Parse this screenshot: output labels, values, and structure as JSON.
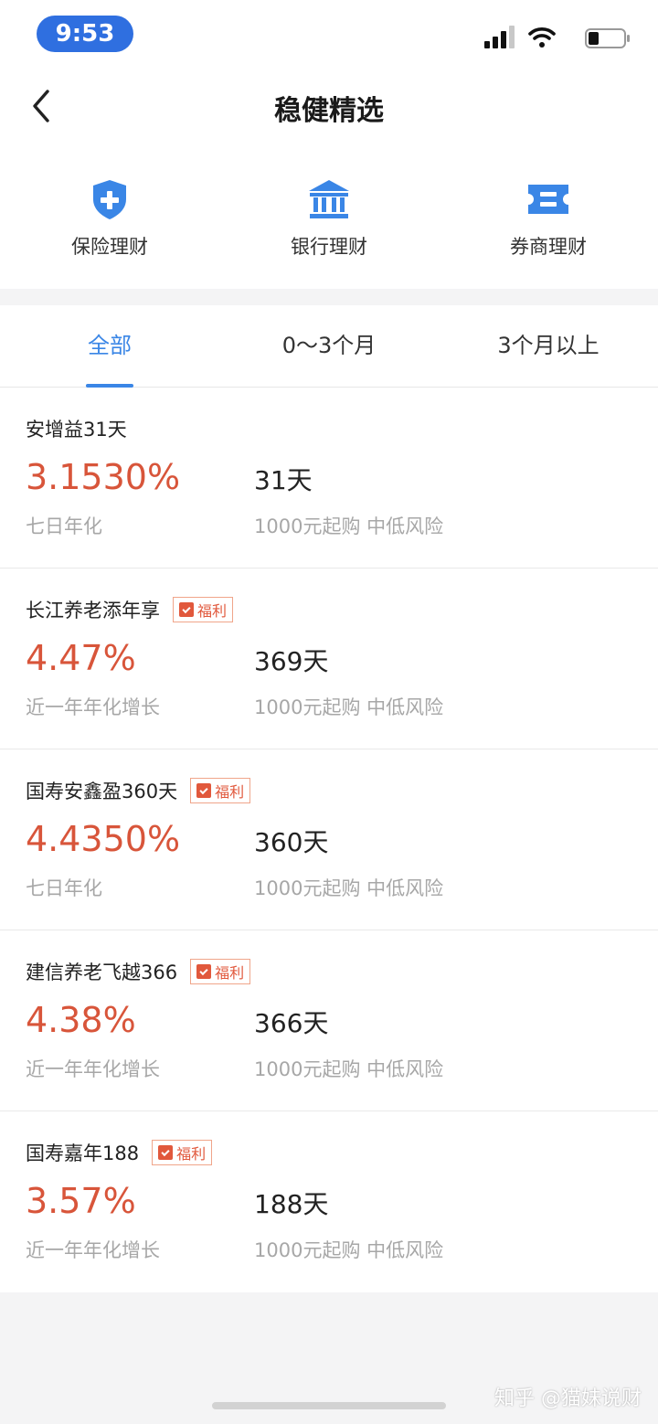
{
  "status_bar": {
    "time": "9:53"
  },
  "header": {
    "title": "稳健精选",
    "back_icon": "chevron-left-icon"
  },
  "categories": [
    {
      "label": "保险理财",
      "icon": "shield-plus-icon"
    },
    {
      "label": "银行理财",
      "icon": "bank-icon"
    },
    {
      "label": "券商理财",
      "icon": "ticket-icon"
    }
  ],
  "tabs": [
    {
      "label": "全部",
      "active": true
    },
    {
      "label": "0～3个月",
      "active": false
    },
    {
      "label": "3个月以上",
      "active": false
    }
  ],
  "products": [
    {
      "name": "安增益31天",
      "badge": "",
      "rate": "3.1530%",
      "rate_label": "七日年化",
      "term": "31天",
      "info": "1000元起购  中低风险"
    },
    {
      "name": "长江养老添年享",
      "badge": "福利",
      "rate": "4.47%",
      "rate_label": "近一年年化增长",
      "term": "369天",
      "info": "1000元起购  中低风险"
    },
    {
      "name": "国寿安鑫盈360天",
      "badge": "福利",
      "rate": "4.4350%",
      "rate_label": "七日年化",
      "term": "360天",
      "info": "1000元起购  中低风险"
    },
    {
      "name": "建信养老飞越366",
      "badge": "福利",
      "rate": "4.38%",
      "rate_label": "近一年年化增长",
      "term": "366天",
      "info": "1000元起购  中低风险"
    },
    {
      "name": "国寿嘉年188",
      "badge": "福利",
      "rate": "3.57%",
      "rate_label": "近一年年化增长",
      "term": "188天",
      "info": "1000元起购  中低风险"
    }
  ],
  "watermark": "知乎 @猫妹说财",
  "colors": {
    "accent": "#3a86e6",
    "rate": "#d8553a",
    "icon_blue": "#3a86e6",
    "time_pill": "#2f6fe0"
  }
}
